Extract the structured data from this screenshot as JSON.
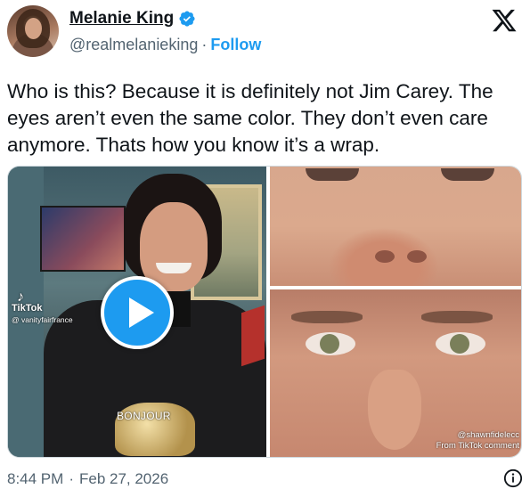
{
  "author": {
    "display_name": "Melanie King",
    "handle": "@realmelanieking",
    "separator": "·",
    "follow_label": "Follow",
    "verified": true
  },
  "brand": {
    "logo_icon": "x-logo-icon"
  },
  "tweet": {
    "text": "Who is this? Because it is definitely not Jim Carey. The eyes aren’t even the same color. They don’t even care anymore. Thats how you know it’s a wrap."
  },
  "media": {
    "video": {
      "tiktok_label": "TikTok",
      "tiktok_handle": "@ vanityfairfrance",
      "overlay_text": "BONJOUR",
      "play_icon": "play-icon"
    },
    "image_credit_line1": "@shawnfidelecc",
    "image_credit_line2": "From TikTok comment"
  },
  "footer": {
    "time": "8:44 PM",
    "separator": "·",
    "date": "Feb 27, 2026",
    "info_icon": "info-icon"
  },
  "colors": {
    "accent": "#1d9bf0",
    "text_primary": "#0f1419",
    "text_secondary": "#536471",
    "verified_badge": "#1d9bf0"
  }
}
